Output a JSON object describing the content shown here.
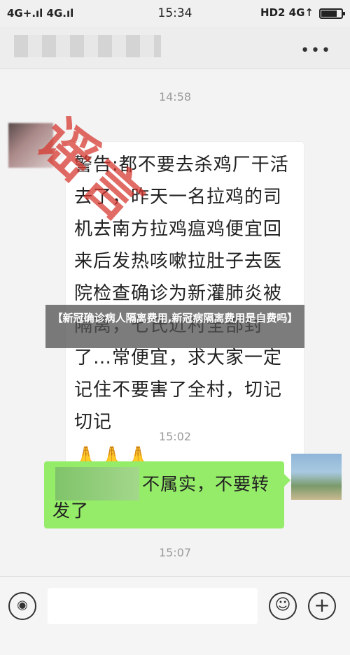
{
  "status_bar": {
    "network": "4G+.ıl 4G.ıl",
    "time": "15:34",
    "right_indicators": "HD2 4G↑",
    "battery_level": 0.85
  },
  "chat": {
    "timestamps": [
      "14:58",
      "15:02",
      "15:07"
    ],
    "incoming_message": "警告:都不要去杀鸡厂干活去了，昨天一名拉鸡的司机去南方拉鸡瘟鸡便宜回来后发热咳嗽拉肚子去医院检查确诊为新灌肺炎被隔离，七氏近村全部封了…常便宜，求大家一定记住不要害了全村，切记切记",
    "prayer_emojis": "🙏🙏🙏",
    "stamp_text": "谣言",
    "outgoing_message": "不属实，不要转发了"
  },
  "overlay_caption": "【新冠确诊病人隔离费用,新冠病隔离费用是自费吗】",
  "icons": {
    "menu": "more-dots-icon",
    "voice": "voice-icon",
    "emoji": "emoji-icon",
    "plus": "plus-icon"
  },
  "colors": {
    "outgoing_bubble": "#95ec69",
    "stamp": "#d6332a"
  }
}
